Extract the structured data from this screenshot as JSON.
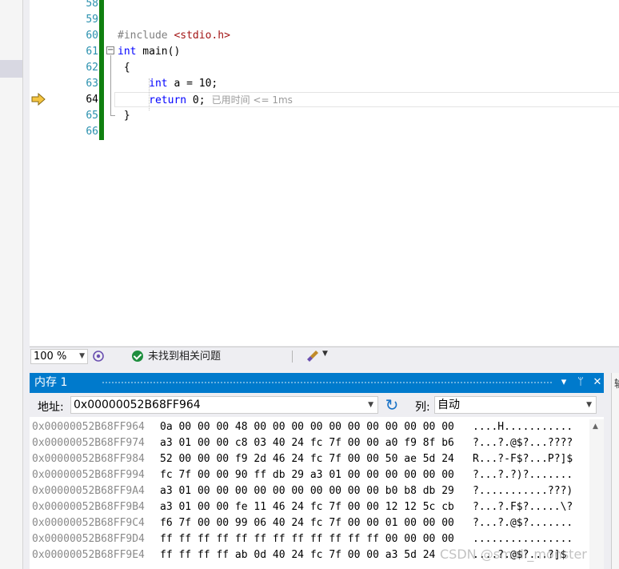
{
  "editor": {
    "lines": [
      {
        "num": "58",
        "segments": []
      },
      {
        "num": "59",
        "segments": []
      },
      {
        "num": "60",
        "segments": [
          {
            "t": "#include ",
            "c": "pp"
          },
          {
            "t": "<stdio.h>",
            "c": "str"
          }
        ]
      },
      {
        "num": "61",
        "segments": [
          {
            "t": "int",
            "c": "kw"
          },
          {
            "t": " main()",
            "c": ""
          }
        ]
      },
      {
        "num": "62",
        "segments": [
          {
            "t": " {",
            "c": ""
          }
        ]
      },
      {
        "num": "63",
        "segments": [
          {
            "t": "     ",
            "c": ""
          },
          {
            "t": "int",
            "c": "kw"
          },
          {
            "t": " a = 10;",
            "c": ""
          }
        ]
      },
      {
        "num": "64",
        "segments": [
          {
            "t": "     ",
            "c": ""
          },
          {
            "t": "return",
            "c": "kw"
          },
          {
            "t": " 0;",
            "c": ""
          }
        ],
        "hint": "已用时间 <= 1ms",
        "current": true
      },
      {
        "num": "65",
        "segments": [
          {
            "t": " }",
            "c": ""
          }
        ]
      },
      {
        "num": "66",
        "segments": []
      }
    ],
    "collapse_symbol": "−",
    "execution_arrow_icon": "yellow-arrow-icon"
  },
  "status": {
    "zoom": "100 %",
    "issues": "未找到相关问题",
    "issues_icon": "check-circle-icon",
    "cleanup_icon": "brush-icon"
  },
  "memory": {
    "title": "内存 1",
    "buttons": {
      "dropdown": "▾",
      "pin": "ᛘ",
      "close": "✕"
    },
    "address_label": "地址:",
    "address_value": "0x00000052B68FF964",
    "columns_label": "列:",
    "columns_value": "自动",
    "rows": [
      {
        "addr": "0x00000052B68FF964",
        "hex": "0a 00 00 00 48 00 00 00 00 00 00 00 00 00 00 00",
        "ascii": "....H..........."
      },
      {
        "addr": "0x00000052B68FF974",
        "hex": "a3 01 00 00 c8 03 40 24 fc 7f 00 00 a0 f9 8f b6",
        "ascii": "?...?.@$?...????"
      },
      {
        "addr": "0x00000052B68FF984",
        "hex": "52 00 00 00 f9 2d 46 24 fc 7f 00 00 50 ae 5d 24",
        "ascii": "R...?-F$?...P?]$"
      },
      {
        "addr": "0x00000052B68FF994",
        "hex": "fc 7f 00 00 90 ff db 29 a3 01 00 00 00 00 00 00",
        "ascii": "?...?.?)?......."
      },
      {
        "addr": "0x00000052B68FF9A4",
        "hex": "a3 01 00 00 00 00 00 00 00 00 00 00 b0 b8 db 29",
        "ascii": "?...........???)"
      },
      {
        "addr": "0x00000052B68FF9B4",
        "hex": "a3 01 00 00 fe 11 46 24 fc 7f 00 00 12 12 5c cb",
        "ascii": "?...?.F$?.....\\?"
      },
      {
        "addr": "0x00000052B68FF9C4",
        "hex": "f6 7f 00 00 99 06 40 24 fc 7f 00 00 01 00 00 00",
        "ascii": "?...?.@$?......."
      },
      {
        "addr": "0x00000052B68FF9D4",
        "hex": "ff ff ff ff ff ff ff ff ff ff ff ff 00 00 00 00",
        "ascii": "................"
      },
      {
        "addr": "0x00000052B68FF9E4",
        "hex": "ff ff ff ff ab 0d 40 24 fc 7f 00 00 a3 5d 24",
        "ascii": "....?.@$?...?]$"
      }
    ]
  },
  "right_panel_tab": "输",
  "watermark": "CSDN @small_monster"
}
